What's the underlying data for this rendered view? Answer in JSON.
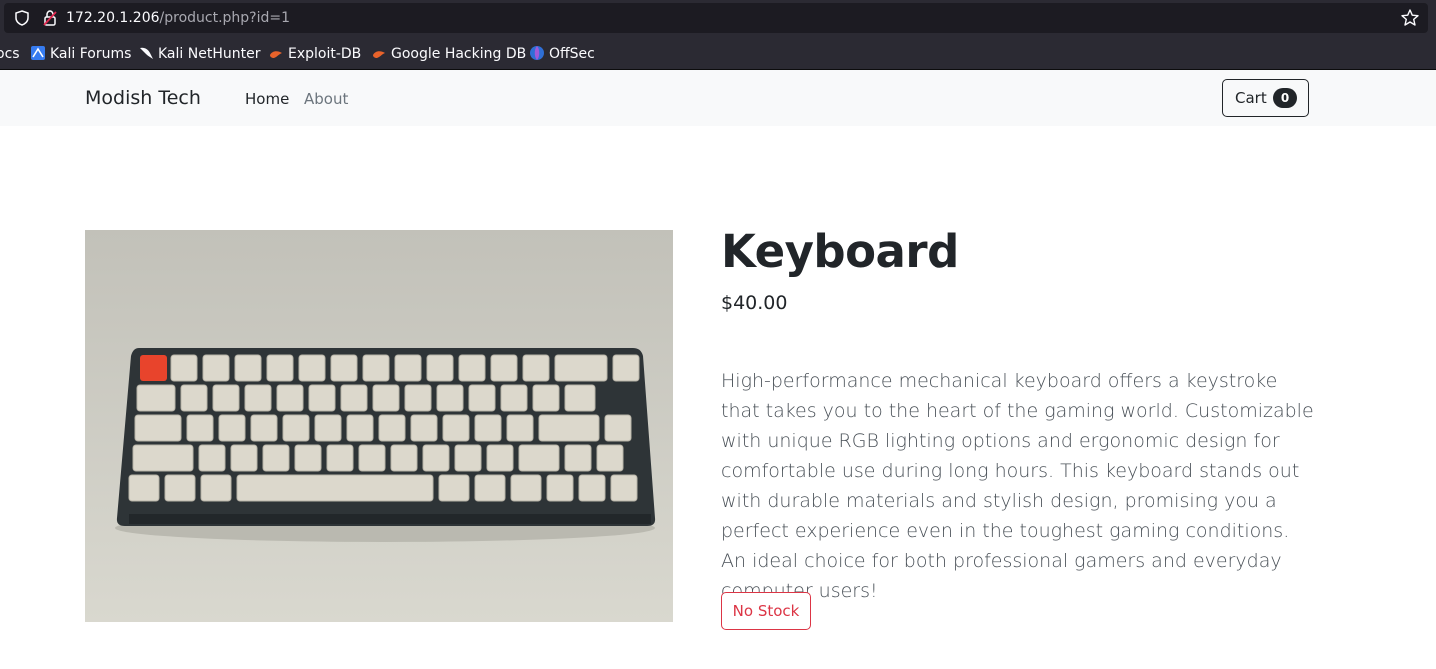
{
  "browser": {
    "url_host": "172.20.1.206",
    "url_path": "/product.php?id=1",
    "bookmarks": [
      {
        "label": "ocs",
        "icon": "doc-icon"
      },
      {
        "label": "Kali Forums",
        "icon": "kali-forums-icon"
      },
      {
        "label": "Kali NetHunter",
        "icon": "kali-dragon-icon"
      },
      {
        "label": "Exploit-DB",
        "icon": "exploitdb-icon"
      },
      {
        "label": "Google Hacking DB",
        "icon": "ghdb-icon"
      },
      {
        "label": "OffSec",
        "icon": "offsec-icon"
      }
    ]
  },
  "navbar": {
    "brand": "Modish Tech",
    "links": [
      {
        "label": "Home",
        "active": true
      },
      {
        "label": "About",
        "active": false
      }
    ],
    "cart_label": "Cart",
    "cart_count": "0"
  },
  "product": {
    "title": "Keyboard",
    "price": "$40.00",
    "description": "High-performance mechanical keyboard offers a keystroke that takes you to the heart of the gaming world. Customizable with unique RGB lighting options and ergonomic design for comfortable use during long hours. This keyboard stands out with durable materials and stylish design, promising you a perfect experience even in the toughest gaming conditions. An ideal choice for both professional gamers and everyday computer users!",
    "stock_label": "No Stock"
  },
  "colors": {
    "danger": "#dc3545",
    "dark": "#212529",
    "navbar_bg": "#f8f9fa",
    "browser_bg": "#2b2a33"
  }
}
